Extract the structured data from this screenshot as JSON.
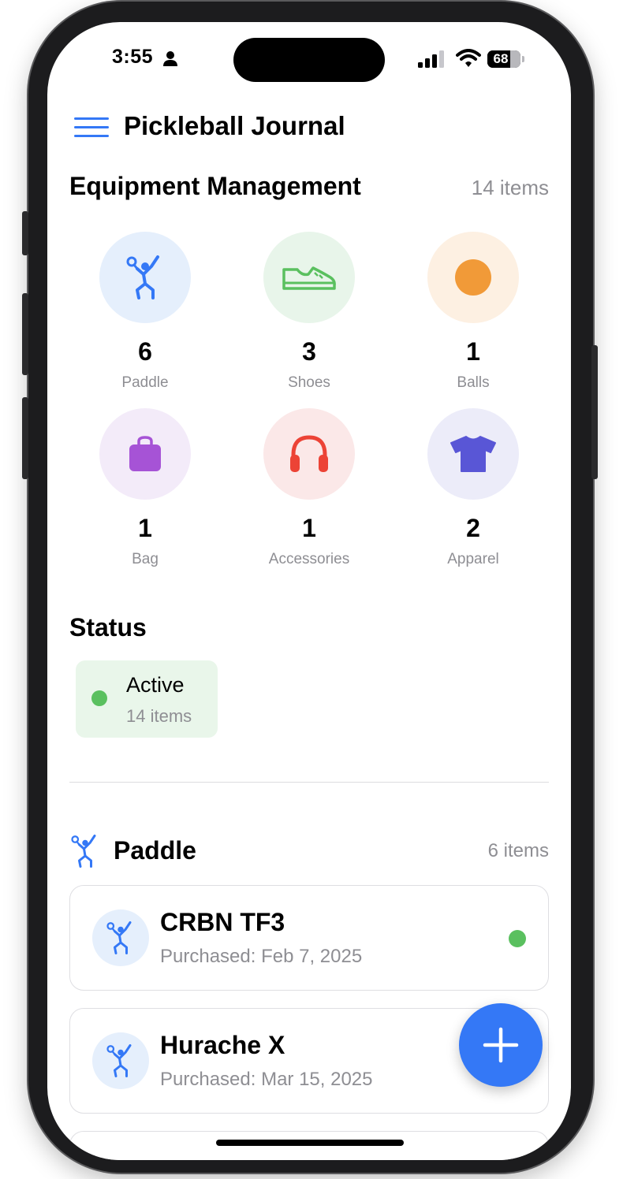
{
  "status_bar": {
    "time": "3:55",
    "battery_level": "68",
    "battery_fraction": 0.68
  },
  "header": {
    "title": "Pickleball Journal",
    "menu_icon": "hamburger-menu-icon"
  },
  "equipment": {
    "title": "Equipment Management",
    "count_label": "14 items",
    "categories": [
      {
        "label": "Paddle",
        "count": "6",
        "icon": "player-icon",
        "bg": "#e5effc",
        "color": "#3478f6"
      },
      {
        "label": "Shoes",
        "count": "3",
        "icon": "shoe-icon",
        "bg": "#e8f5ea",
        "color": "#5ac05f"
      },
      {
        "label": "Balls",
        "count": "1",
        "icon": "ball-icon",
        "bg": "#fdf0e2",
        "color": "#f19a38"
      },
      {
        "label": "Bag",
        "count": "1",
        "icon": "bag-icon",
        "bg": "#f3ebf9",
        "color": "#a653d6"
      },
      {
        "label": "Accessories",
        "count": "1",
        "icon": "headphones-icon",
        "bg": "#fbe8e8",
        "color": "#ec4336"
      },
      {
        "label": "Apparel",
        "count": "2",
        "icon": "tshirt-icon",
        "bg": "#ececf9",
        "color": "#5956d6"
      }
    ]
  },
  "status_section": {
    "title": "Status",
    "cards": [
      {
        "name": "Active",
        "count_label": "14 items",
        "color": "#5ac05f",
        "bg": "#e9f6ea"
      }
    ]
  },
  "paddle_section": {
    "title": "Paddle",
    "count_label": "6 items",
    "items": [
      {
        "name": "CRBN TF3",
        "date": "Purchased: Feb 7, 2025",
        "status_color": "#5ac05f"
      },
      {
        "name": "Hurache X",
        "date": "Purchased: Mar 15, 2025"
      }
    ]
  },
  "fab": {
    "icon": "plus-icon",
    "color": "#3478f6"
  }
}
